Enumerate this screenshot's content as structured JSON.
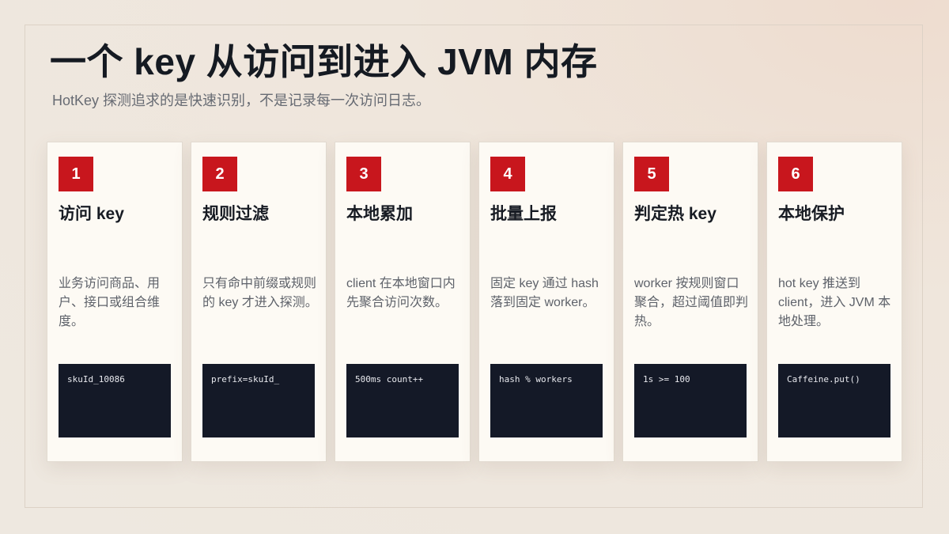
{
  "header": {
    "title": "一个 key 从访问到进入 JVM 内存",
    "subtitle": "HotKey 探测追求的是快速识别，不是记录每一次访问日志。"
  },
  "steps": [
    {
      "number": "1",
      "title": "访问 key",
      "description": "业务访问商品、用户、接口或组合维度。",
      "code": "skuId_10086"
    },
    {
      "number": "2",
      "title": "规则过滤",
      "description": "只有命中前缀或规则的 key 才进入探测。",
      "code": "prefix=skuId_"
    },
    {
      "number": "3",
      "title": "本地累加",
      "description": "client 在本地窗口内先聚合访问次数。",
      "code": "500ms count++"
    },
    {
      "number": "4",
      "title": "批量上报",
      "description": "固定 key 通过 hash 落到固定 worker。",
      "code": "hash % workers"
    },
    {
      "number": "5",
      "title": "判定热 key",
      "description": "worker 按规则窗口聚合，超过阈值即判热。",
      "code": "1s >= 100"
    },
    {
      "number": "6",
      "title": "本地保护",
      "description": "hot key 推送到 client，进入 JVM 本地处理。",
      "code": "Caffeine.put()"
    }
  ],
  "colors": {
    "accent": "#c8161d",
    "code_background": "#141927",
    "card_background": "#fdfaf4"
  }
}
